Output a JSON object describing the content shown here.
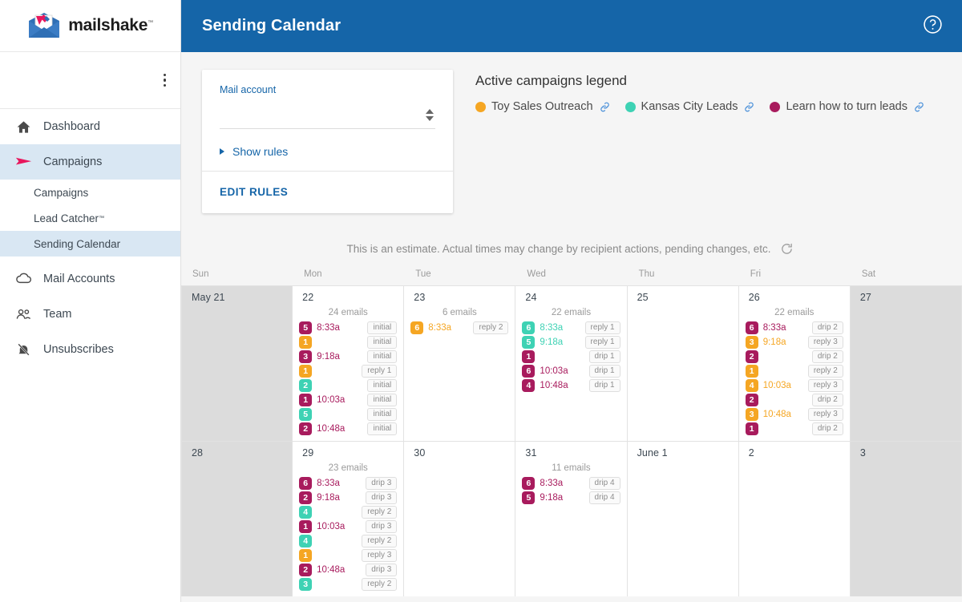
{
  "brand": {
    "name": "mailshake",
    "tm": "™"
  },
  "topbar": {
    "title": "Sending Calendar",
    "help_icon": "help-circle-icon"
  },
  "sidebar": {
    "kebab_icon": "kebab-menu-icon",
    "items": [
      {
        "label": "Dashboard",
        "icon": "home-icon",
        "active": false
      },
      {
        "label": "Campaigns",
        "icon": "send-icon",
        "active": true
      },
      {
        "label": "Mail Accounts",
        "icon": "cloud-icon",
        "active": false
      },
      {
        "label": "Team",
        "icon": "people-icon",
        "active": false
      },
      {
        "label": "Unsubscribes",
        "icon": "bell-off-icon",
        "active": false
      }
    ],
    "sub_items": [
      {
        "label": "Campaigns",
        "tm": "",
        "active": false
      },
      {
        "label": "Lead Catcher",
        "tm": "™",
        "active": false
      },
      {
        "label": "Sending Calendar",
        "tm": "",
        "active": true
      }
    ]
  },
  "rules_card": {
    "field_label": "Mail account",
    "select_value": "",
    "select_placeholder": "",
    "show_rules_label": "Show rules",
    "edit_rules_label": "EDIT RULES"
  },
  "legend": {
    "title": "Active campaigns legend",
    "campaigns": [
      {
        "name": "Toy Sales Outreach",
        "color": "#f5a623"
      },
      {
        "name": "Kansas City Leads",
        "color": "#3ed2b4"
      },
      {
        "name": "Learn how to turn leads",
        "color": "#a81b5d"
      }
    ],
    "link_icon": "link-icon"
  },
  "calendar": {
    "estimate_note": "This is an estimate. Actual times may change by recipient actions, pending changes, etc.",
    "refresh_icon": "refresh-icon",
    "day_headers": [
      "Sun",
      "Mon",
      "Tue",
      "Wed",
      "Thu",
      "Fri",
      "Sat"
    ],
    "weeks": [
      {
        "days": [
          {
            "date": "May 21",
            "dim": true,
            "count": "",
            "events": []
          },
          {
            "date": "22",
            "dim": false,
            "count": "24 emails",
            "events": [
              {
                "num": "5",
                "color": "#a81b5d",
                "time": "8:33a",
                "tag": "initial"
              },
              {
                "num": "1",
                "color": "#f5a623",
                "time": "",
                "tag": "initial"
              },
              {
                "num": "3",
                "color": "#a81b5d",
                "time": "9:18a",
                "tag": "initial"
              },
              {
                "num": "1",
                "color": "#f5a623",
                "time": "",
                "tag": "reply 1"
              },
              {
                "num": "2",
                "color": "#3ed2b4",
                "time": "",
                "tag": "initial"
              },
              {
                "num": "1",
                "color": "#a81b5d",
                "time": "10:03a",
                "tag": "initial"
              },
              {
                "num": "5",
                "color": "#3ed2b4",
                "time": "",
                "tag": "initial"
              },
              {
                "num": "2",
                "color": "#a81b5d",
                "time": "10:48a",
                "tag": "initial"
              }
            ]
          },
          {
            "date": "23",
            "dim": false,
            "count": "6 emails",
            "events": [
              {
                "num": "6",
                "color": "#f5a623",
                "time": "8:33a",
                "tag": "reply 2"
              }
            ]
          },
          {
            "date": "24",
            "dim": false,
            "count": "22 emails",
            "events": [
              {
                "num": "6",
                "color": "#3ed2b4",
                "time": "8:33a",
                "tag": "reply 1"
              },
              {
                "num": "5",
                "color": "#3ed2b4",
                "time": "9:18a",
                "tag": "reply 1"
              },
              {
                "num": "1",
                "color": "#a81b5d",
                "time": "",
                "tag": "drip 1"
              },
              {
                "num": "6",
                "color": "#a81b5d",
                "time": "10:03a",
                "tag": "drip 1"
              },
              {
                "num": "4",
                "color": "#a81b5d",
                "time": "10:48a",
                "tag": "drip 1"
              }
            ]
          },
          {
            "date": "25",
            "dim": false,
            "count": "",
            "events": []
          },
          {
            "date": "26",
            "dim": false,
            "count": "22 emails",
            "events": [
              {
                "num": "6",
                "color": "#a81b5d",
                "time": "8:33a",
                "tag": "drip 2"
              },
              {
                "num": "3",
                "color": "#f5a623",
                "time": "9:18a",
                "tag": "reply 3"
              },
              {
                "num": "2",
                "color": "#a81b5d",
                "time": "",
                "tag": "drip 2"
              },
              {
                "num": "1",
                "color": "#f5a623",
                "time": "",
                "tag": "reply 2"
              },
              {
                "num": "4",
                "color": "#f5a623",
                "time": "10:03a",
                "tag": "reply 3"
              },
              {
                "num": "2",
                "color": "#a81b5d",
                "time": "",
                "tag": "drip 2"
              },
              {
                "num": "3",
                "color": "#f5a623",
                "time": "10:48a",
                "tag": "reply 3"
              },
              {
                "num": "1",
                "color": "#a81b5d",
                "time": "",
                "tag": "drip 2"
              }
            ]
          },
          {
            "date": "27",
            "dim": true,
            "count": "",
            "events": []
          }
        ]
      },
      {
        "days": [
          {
            "date": "28",
            "dim": true,
            "count": "",
            "events": []
          },
          {
            "date": "29",
            "dim": false,
            "count": "23 emails",
            "events": [
              {
                "num": "6",
                "color": "#a81b5d",
                "time": "8:33a",
                "tag": "drip 3"
              },
              {
                "num": "2",
                "color": "#a81b5d",
                "time": "9:18a",
                "tag": "drip 3"
              },
              {
                "num": "4",
                "color": "#3ed2b4",
                "time": "",
                "tag": "reply 2"
              },
              {
                "num": "1",
                "color": "#a81b5d",
                "time": "10:03a",
                "tag": "drip 3"
              },
              {
                "num": "4",
                "color": "#3ed2b4",
                "time": "",
                "tag": "reply 2"
              },
              {
                "num": "1",
                "color": "#f5a623",
                "time": "",
                "tag": "reply 3"
              },
              {
                "num": "2",
                "color": "#a81b5d",
                "time": "10:48a",
                "tag": "drip 3"
              },
              {
                "num": "3",
                "color": "#3ed2b4",
                "time": "",
                "tag": "reply 2"
              }
            ]
          },
          {
            "date": "30",
            "dim": false,
            "count": "",
            "events": []
          },
          {
            "date": "31",
            "dim": false,
            "count": "11 emails",
            "events": [
              {
                "num": "6",
                "color": "#a81b5d",
                "time": "8:33a",
                "tag": "drip 4"
              },
              {
                "num": "5",
                "color": "#a81b5d",
                "time": "9:18a",
                "tag": "drip 4"
              }
            ]
          },
          {
            "date": "June 1",
            "dim": false,
            "count": "",
            "events": []
          },
          {
            "date": "2",
            "dim": false,
            "count": "",
            "events": []
          },
          {
            "date": "3",
            "dim": true,
            "count": "",
            "events": []
          }
        ]
      }
    ]
  }
}
